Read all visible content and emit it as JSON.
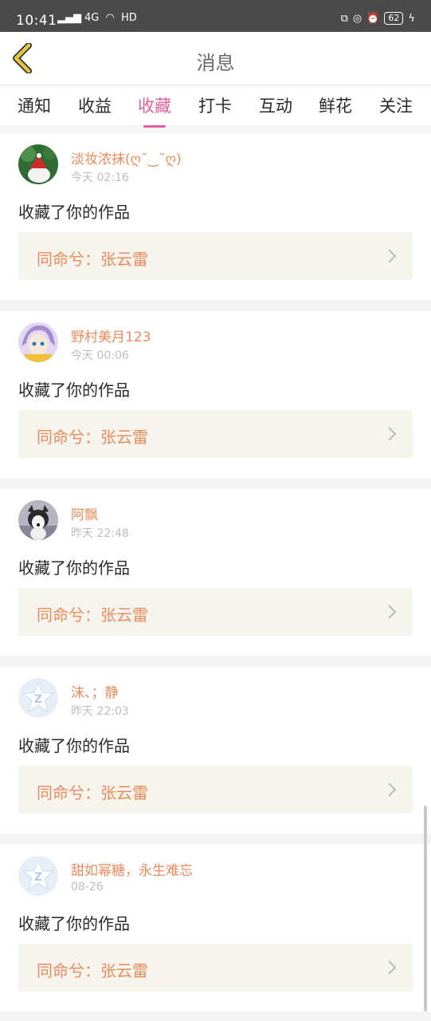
{
  "status_bar": {
    "time": "10:41",
    "network": "4G",
    "hd": "HD",
    "battery": "62"
  },
  "header": {
    "title": "消息"
  },
  "tabs": [
    {
      "label": "通知",
      "active": false
    },
    {
      "label": "收益",
      "active": false
    },
    {
      "label": "收藏",
      "active": true
    },
    {
      "label": "打卡",
      "active": false
    },
    {
      "label": "互动",
      "active": false
    },
    {
      "label": "鲜花",
      "active": false
    },
    {
      "label": "关注",
      "active": false
    }
  ],
  "messages": [
    {
      "username": "淡妆浓抹(ღ˘‿˘ღ)",
      "time": "今天 02:16",
      "action": "收藏了你的作品",
      "work": "同命兮：张云雷",
      "avatar_icon": "red-hat-dog-avatar"
    },
    {
      "username": "野村美月123",
      "time": "今天 00:06",
      "action": "收藏了你的作品",
      "work": "同命兮：张云雷",
      "avatar_icon": "anime-character-avatar"
    },
    {
      "username": "阿飘",
      "time": "昨天 22:48",
      "action": "收藏了你的作品",
      "work": "同命兮：张云雷",
      "avatar_icon": "husky-avatar"
    },
    {
      "username": "沫、；静",
      "time": "昨天 22:03",
      "action": "收藏了你的作品",
      "work": "同命兮：张云雷",
      "avatar_icon": "default-z-avatar"
    },
    {
      "username": "甜如幂糖，永生难忘",
      "time": "08-26",
      "action": "收藏了你的作品",
      "work": "同命兮：张云雷",
      "avatar_icon": "default-z-avatar"
    }
  ],
  "colors": {
    "accent_pink": "#e0609d",
    "username_orange": "#ec8a5c",
    "work_bg": "#f5f5ee",
    "back_icon_yellow": "#e6c542"
  }
}
